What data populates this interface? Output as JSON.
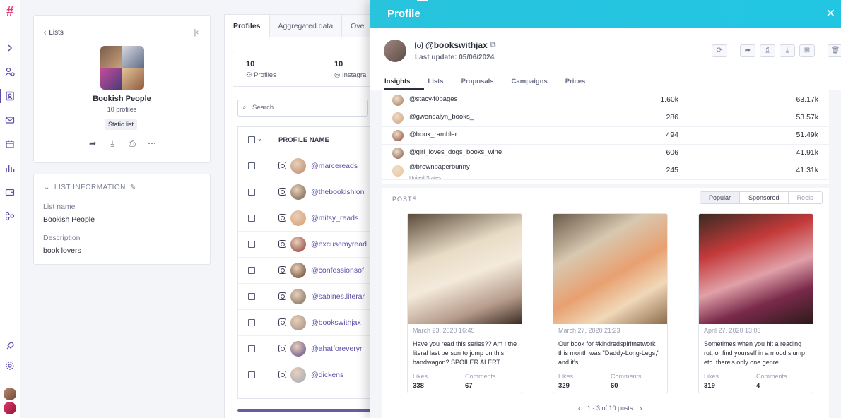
{
  "rail": {
    "logo": "#",
    "icons": [
      "expand-icon",
      "users-icon",
      "contacts-icon",
      "mail-icon",
      "calendar-icon",
      "chart-icon",
      "wallet-icon",
      "network-icon",
      "rocket-icon",
      "gear-icon"
    ]
  },
  "list_card": {
    "back_label": "Lists",
    "name": "Bookish People",
    "count": "10 profiles",
    "badge": "Static list"
  },
  "list_info": {
    "header": "LIST INFORMATION",
    "name_label": "List name",
    "name_value": "Bookish People",
    "desc_label": "Description",
    "desc_value": "book lovers"
  },
  "middle": {
    "tabs": [
      "Profiles",
      "Aggregated data",
      "Ove"
    ],
    "stats": [
      {
        "value": "10",
        "label": "Profiles"
      },
      {
        "value": "10",
        "label": "Instagra"
      }
    ],
    "search_placeholder": "Search",
    "column_header": "PROFILE NAME",
    "rows": [
      {
        "handle": "@marcereads",
        "color": "#b98a6e"
      },
      {
        "handle": "@thebookishlon",
        "color": "#6d5a4a"
      },
      {
        "handle": "@mitsy_reads",
        "color": "#d99a6e"
      },
      {
        "handle": "@excusemyread",
        "color": "#8a3a3a"
      },
      {
        "handle": "@confessionsof",
        "color": "#5a3a2a"
      },
      {
        "handle": "@sabines.literar",
        "color": "#7a6a5a"
      },
      {
        "handle": "@bookswithjax",
        "color": "#9e8a82"
      },
      {
        "handle": "@ahatforeveryr",
        "color": "#5a4a8a"
      },
      {
        "handle": "@dickens",
        "color": "#a0a8b8"
      }
    ]
  },
  "drawer": {
    "title": "Profile",
    "handle": "@bookswithjax",
    "last_update": "Last update: 05/06/2024",
    "tabs": [
      "Insights",
      "Lists",
      "Proposals",
      "Campaigns",
      "Prices"
    ],
    "top_profiles": [
      {
        "handle": "@stacy40pages",
        "sub": "",
        "v1": "1.60k",
        "v2": "63.17k",
        "color": "#a07a5a"
      },
      {
        "handle": "@gwendalyn_books_",
        "sub": "",
        "v1": "286",
        "v2": "53.57k",
        "color": "#c9a080"
      },
      {
        "handle": "@book_rambler",
        "sub": "",
        "v1": "494",
        "v2": "51.49k",
        "color": "#8a4a3a"
      },
      {
        "handle": "@girl_loves_dogs_books_wine",
        "sub": "",
        "v1": "606",
        "v2": "41.91k",
        "color": "#7a5a4a"
      },
      {
        "handle": "@brownpaperbunny",
        "sub": "United States",
        "v1": "245",
        "v2": "41.31k",
        "color": "#e3c59a"
      }
    ],
    "posts_title": "POSTS",
    "segments": [
      "Popular",
      "Sponsored",
      "Reels"
    ],
    "likes_label": "Likes",
    "comments_label": "Comments",
    "posts": [
      {
        "date": "March 23, 2020 16:45",
        "caption": "Have you read this series?? Am I the literal last person to jump on this bandwagon? SPOILER ALERT...",
        "likes": "338",
        "comments": "67"
      },
      {
        "date": "March 27, 2020 21:23",
        "caption": "Our book for #kindredspiritnetwork this month was \"Daddy-Long-Legs,\" and it's ...",
        "likes": "329",
        "comments": "60"
      },
      {
        "date": "April 27, 2020 13:03",
        "caption": "Sometimes when you hit a reading rut, or find yourself in a mood slump etc. there's only one genre...",
        "likes": "319",
        "comments": "4"
      }
    ],
    "pager": "1 - 3 of 10 posts"
  }
}
